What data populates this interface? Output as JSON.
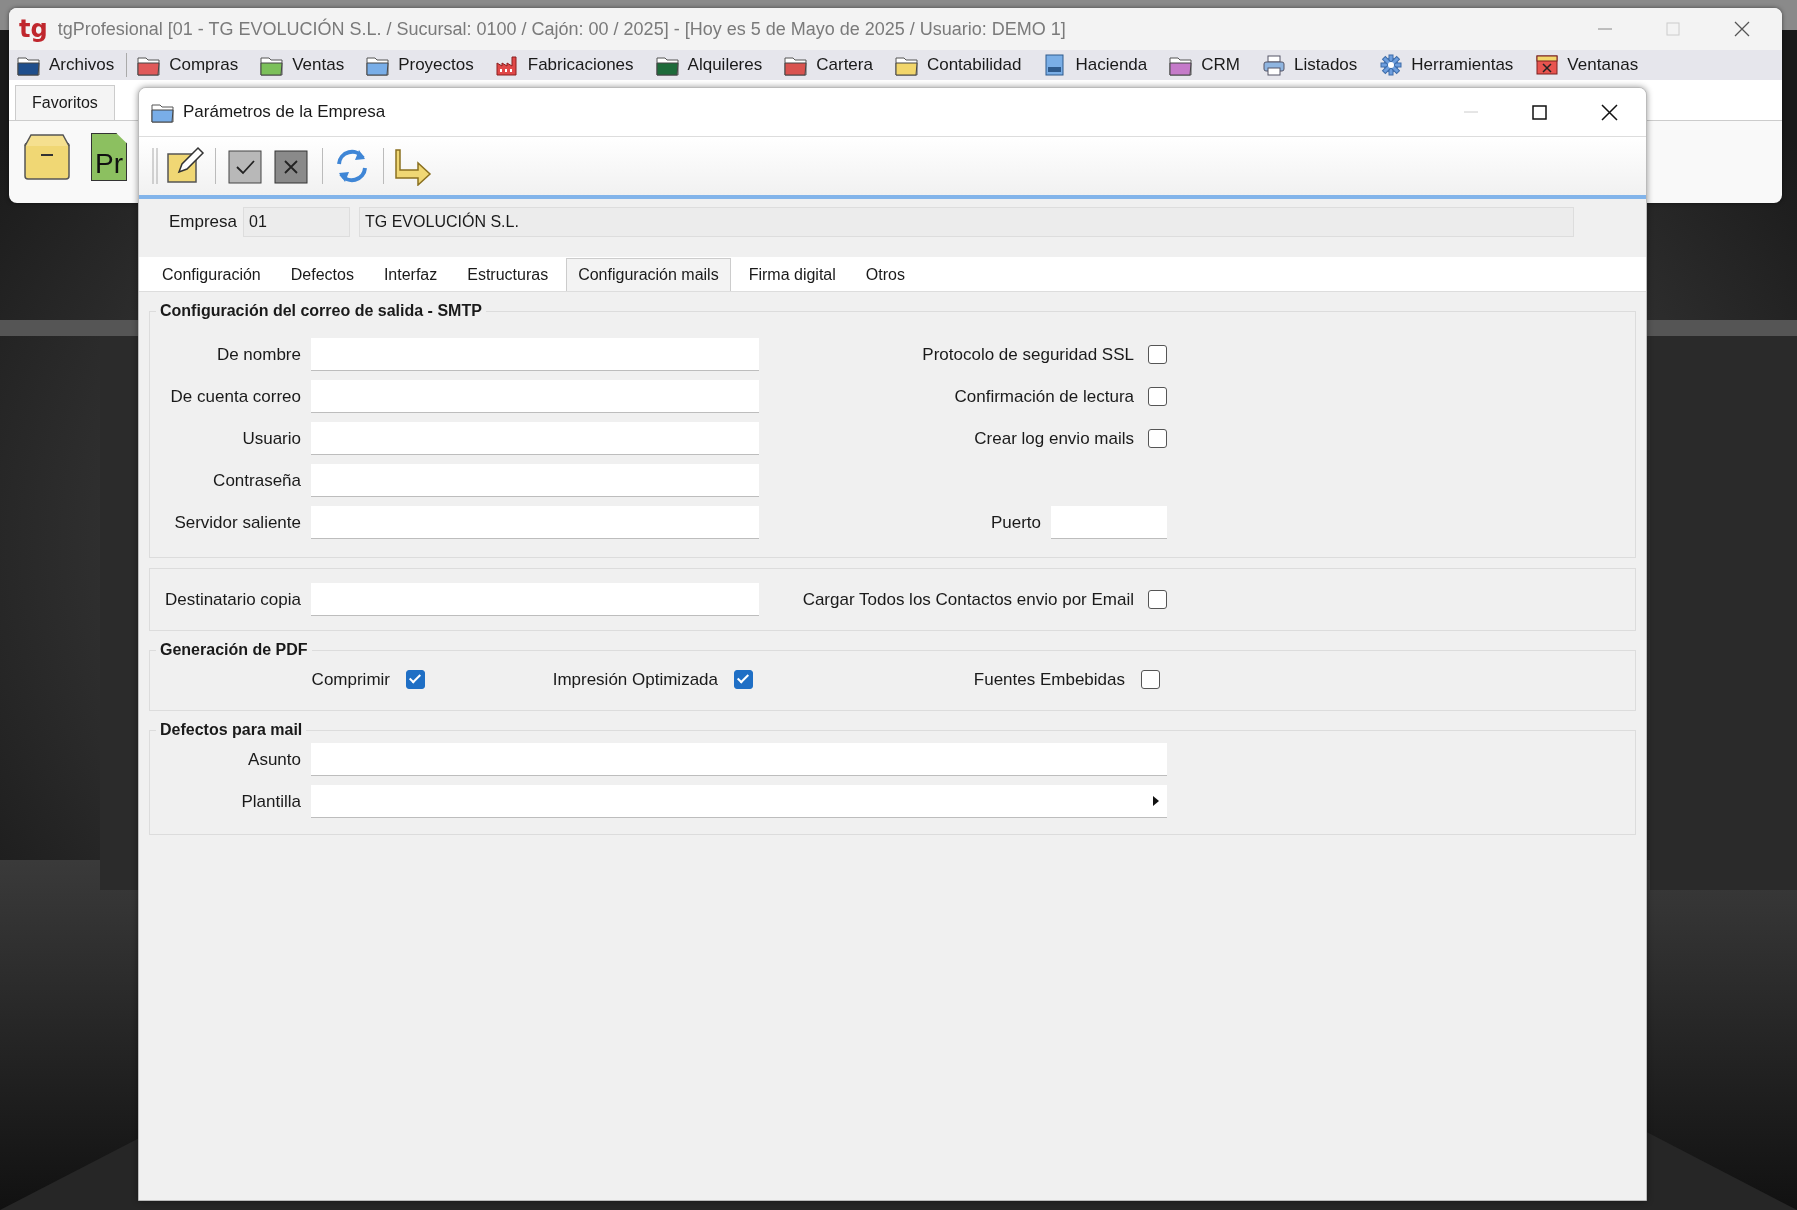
{
  "app_window": {
    "logo": "tg",
    "title": "tgProfesional [01 - TG EVOLUCIÓN S.L. / Sucursal: 0100 / Cajón: 00 / 2025] - [Hoy es 5 de Mayo de 2025 / Usuario: DEMO 1]",
    "menu": [
      {
        "label": "Archivos",
        "kind": "folder",
        "color": "#1f4e8c"
      },
      {
        "label": "Compras",
        "kind": "folder",
        "color": "#e05a5a"
      },
      {
        "label": "Ventas",
        "kind": "folder",
        "color": "#7cc05a"
      },
      {
        "label": "Proyectos",
        "kind": "folder",
        "color": "#79aee8"
      },
      {
        "label": "Fabricaciones",
        "kind": "factory"
      },
      {
        "label": "Alquileres",
        "kind": "folder",
        "color": "#1e6b3a"
      },
      {
        "label": "Cartera",
        "kind": "folder",
        "color": "#d9534f"
      },
      {
        "label": "Contabilidad",
        "kind": "folder",
        "color": "#f2d66b"
      },
      {
        "label": "Hacienda",
        "kind": "tax"
      },
      {
        "label": "CRM",
        "kind": "folder",
        "color": "#c57ac9"
      },
      {
        "label": "Listados",
        "kind": "printer"
      },
      {
        "label": "Herramientas",
        "kind": "gear"
      },
      {
        "label": "Ventanas",
        "kind": "window"
      }
    ],
    "tabs": [
      {
        "label": "Favoritos",
        "selected": true
      }
    ],
    "favorites": [
      {
        "kind": "box"
      },
      {
        "kind": "document",
        "text": "Pr"
      }
    ]
  },
  "dialog": {
    "title": "Parámetros de la Empresa",
    "toolbar": [
      {
        "kind": "edit"
      },
      {
        "kind": "accept"
      },
      {
        "kind": "cancel"
      },
      {
        "kind": "refresh"
      },
      {
        "kind": "exit"
      }
    ],
    "empresa": {
      "label": "Empresa",
      "code": "01",
      "name": "TG EVOLUCIÓN S.L."
    },
    "tabs": [
      {
        "label": "Configuración",
        "selected": false
      },
      {
        "label": "Defectos",
        "selected": false
      },
      {
        "label": "Interfaz",
        "selected": false
      },
      {
        "label": "Estructuras",
        "selected": false
      },
      {
        "label": "Configuración mails",
        "selected": true
      },
      {
        "label": "Firma digital",
        "selected": false
      },
      {
        "label": "Otros",
        "selected": false
      }
    ],
    "smtp": {
      "title": "Configuración del correo de salida - SMTP",
      "rows": [
        {
          "field": {
            "label": "De nombre"
          },
          "option": {
            "kind": "checkbox",
            "label": "Protocolo de seguridad SSL",
            "checked": false
          }
        },
        {
          "field": {
            "label": "De cuenta correo"
          },
          "option": {
            "kind": "checkbox",
            "label": "Confirmación de lectura",
            "checked": false
          }
        },
        {
          "field": {
            "label": "Usuario"
          },
          "option": {
            "kind": "checkbox",
            "label": "Crear log envio mails",
            "checked": false
          }
        },
        {
          "field": {
            "label": "Contraseña"
          }
        },
        {
          "field": {
            "label": "Servidor saliente"
          },
          "option": {
            "kind": "input",
            "label": "Puerto"
          }
        }
      ]
    },
    "copy": {
      "rows": [
        {
          "field": {
            "label": "Destinatario copia"
          },
          "option": {
            "kind": "checkbox",
            "label": "Cargar Todos los Contactos envio por Email",
            "checked": false
          }
        }
      ]
    },
    "pdf": {
      "title": "Generación de PDF",
      "options": [
        {
          "label": "Comprimir",
          "checked": true
        },
        {
          "label": "Impresión Optimizada",
          "checked": true
        },
        {
          "label": "Fuentes Embebidas",
          "checked": false
        }
      ]
    },
    "mail_defaults": {
      "title": "Defectos para mail",
      "fields": [
        {
          "label": "Asunto",
          "kind": "text"
        },
        {
          "label": "Plantilla",
          "kind": "dropdown"
        }
      ]
    }
  }
}
